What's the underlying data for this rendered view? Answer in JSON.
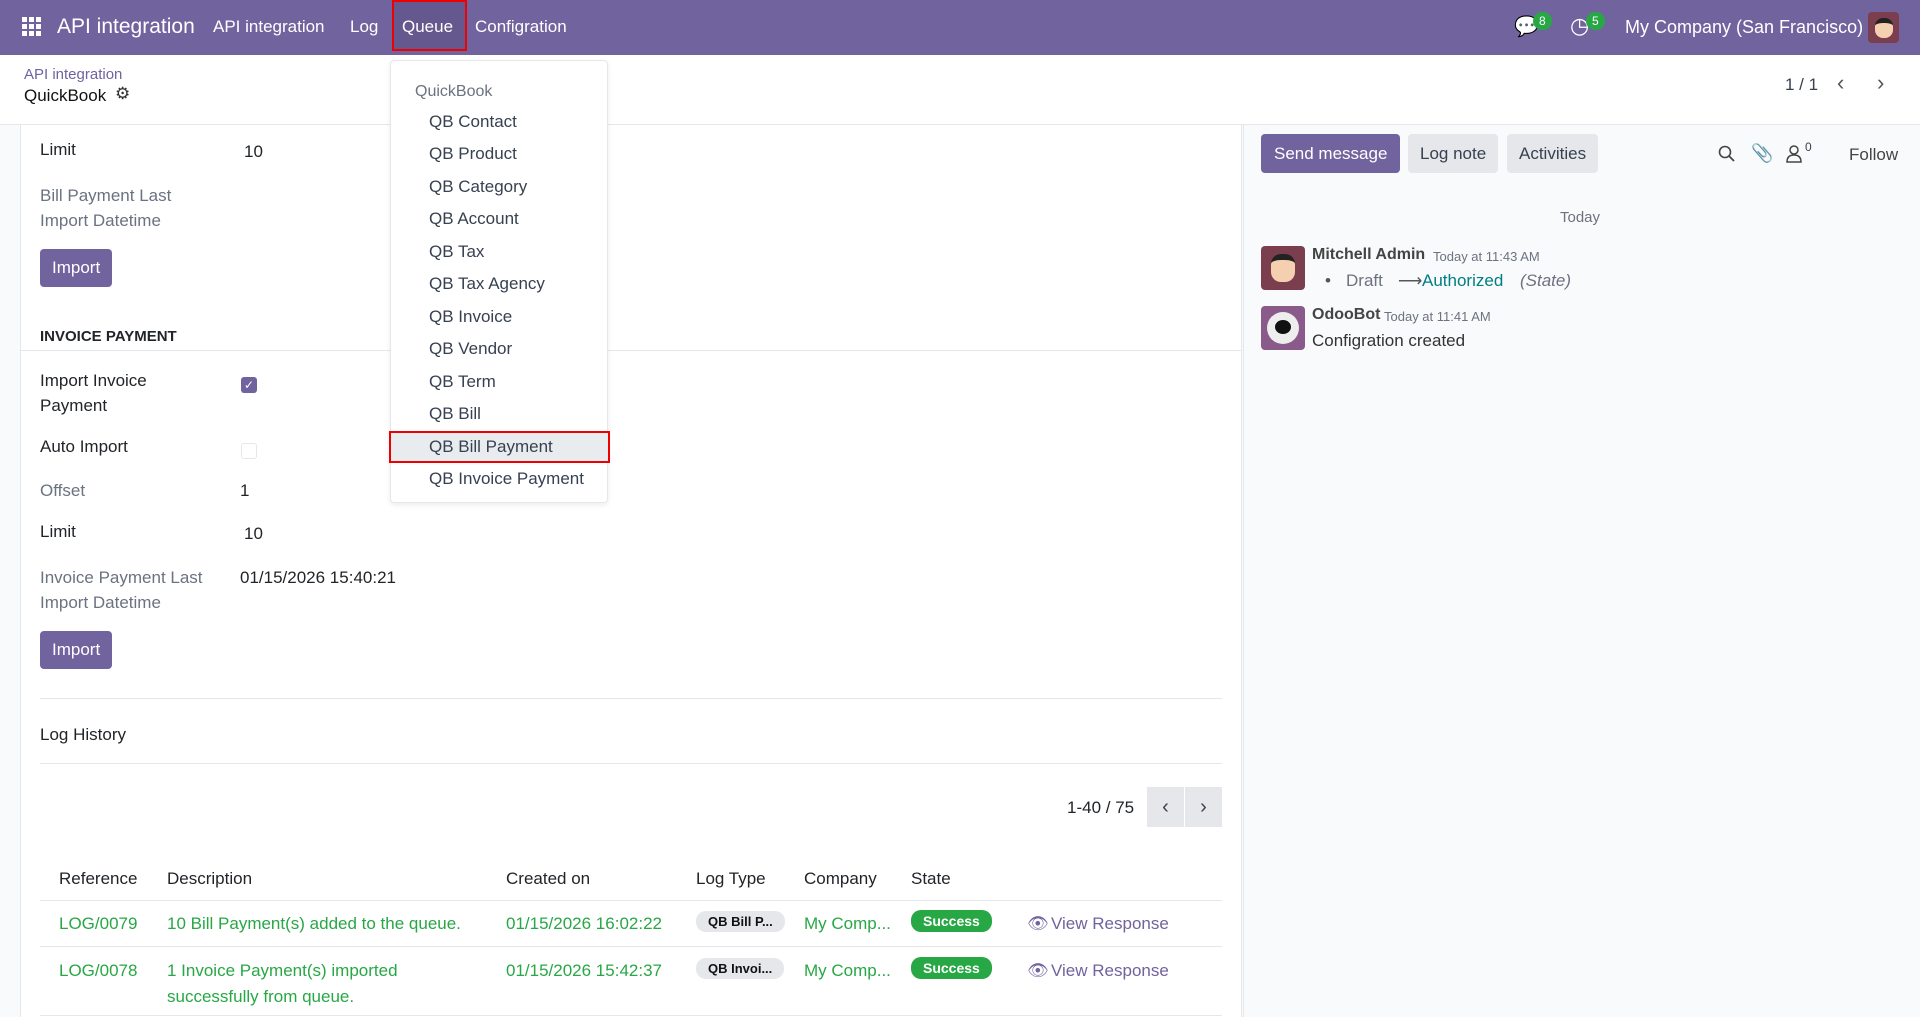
{
  "nav": {
    "app": "API integration",
    "menu": [
      "API integration",
      "Log",
      "Queue",
      "Configration"
    ],
    "messages_count": "8",
    "activities_count": "5",
    "company": "My Company (San Francisco)"
  },
  "breadcrumb": {
    "parent": "API integration",
    "current": "QuickBook"
  },
  "pager": {
    "text": "1 / 1"
  },
  "form": {
    "limit1_label": "Limit",
    "limit1_value": "10",
    "bill_last_label1": "Bill Payment Last",
    "bill_last_label2": "Import Datetime",
    "import_label": "Import",
    "section": "INVOICE PAYMENT",
    "import_invoice_label1": "Import Invoice",
    "import_invoice_label2": "Payment",
    "import_invoice_checked": true,
    "auto_import_label": "Auto Import",
    "auto_import_checked": false,
    "offset_label": "Offset",
    "offset_value": "1",
    "limit2_label": "Limit",
    "limit2_value": "10",
    "inv_last_label1": "Invoice Payment Last",
    "inv_last_label2": "Import Datetime",
    "inv_last_value": "01/15/2026 15:40:21",
    "log_history": "Log History"
  },
  "log": {
    "pager": "1-40 / 75",
    "columns": [
      "Reference",
      "Description",
      "Created on",
      "Log Type",
      "Company",
      "State"
    ],
    "rows": [
      {
        "ref": "LOG/0079",
        "desc1": "10 Bill Payment(s) added to the queue.",
        "desc2": "",
        "created": "01/15/2026 16:02:22",
        "type": "QB Bill P...",
        "company": "My Comp...",
        "state": "Success",
        "action": "View Response"
      },
      {
        "ref": "LOG/0078",
        "desc1": "1 Invoice Payment(s) imported",
        "desc2": "successfully from queue.",
        "created": "01/15/2026 15:42:37",
        "type": "QB Invoi...",
        "company": "My Comp...",
        "state": "Success",
        "action": "View Response"
      }
    ]
  },
  "dropdown": {
    "header": "QuickBook",
    "items": [
      "QB Contact",
      "QB Product",
      "QB Category",
      "QB Account",
      "QB Tax",
      "QB Tax Agency",
      "QB Invoice",
      "QB Vendor",
      "QB Term",
      "QB Bill",
      "QB Bill Payment",
      "QB Invoice Payment"
    ],
    "active": "QB Bill Payment"
  },
  "chatter": {
    "send": "Send message",
    "log": "Log note",
    "activities": "Activities",
    "followers": "0",
    "follow": "Follow",
    "today": "Today",
    "messages": [
      {
        "author": "Mitchell Admin",
        "time": "Today at 11:43 AM",
        "old": "Draft",
        "new": "Authorized",
        "field": "(State)"
      },
      {
        "author": "OdooBot",
        "time": "Today at 11:41 AM",
        "body": "Configration created"
      }
    ]
  }
}
